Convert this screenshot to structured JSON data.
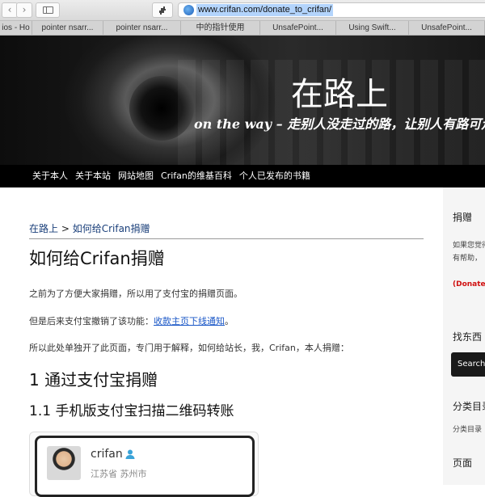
{
  "browser": {
    "nav_back": "‹",
    "nav_forward": "›",
    "url": "www.crifan.com/donate_to_crifan/",
    "tabs": [
      {
        "label": "ios - Ho",
        "width": 40
      },
      {
        "label": "pointer nsarr...",
        "width": 88
      },
      {
        "label": "pointer nsarr...",
        "width": 96
      },
      {
        "label": "中的指针使用",
        "width": 98
      },
      {
        "label": "UnsafePoint...",
        "width": 94
      },
      {
        "label": "Using Swift...",
        "width": 90
      },
      {
        "label": "UnsafePoint...",
        "width": 94
      }
    ]
  },
  "header": {
    "title": "在路上",
    "tagline": "on the way – 走别人没走过的路，让别人有路可走"
  },
  "nav": {
    "items": [
      "关于本人",
      "关于本站",
      "网站地图",
      "Crifan的维基百科",
      "个人已发布的书籍"
    ]
  },
  "content": {
    "breadcrumb_home": "在路上",
    "breadcrumb_sep": " > ",
    "breadcrumb_current": "如何给Crifan捐赠",
    "title": "如何给Crifan捐赠",
    "para1": "之前为了方便大家捐赠，所以用了支付宝的捐赠页面。",
    "para2_prefix": "但是后来支付宝撤销了该功能：",
    "para2_link": "收款主页下线通知",
    "para2_suffix": "。",
    "para3": "所以此处单独开了此页面，专门用于解释，如何给站长，我，Crifan，本人捐赠：",
    "h1": "1 通过支付宝捐赠",
    "h2": "1.1 手机版支付宝扫描二维码转账",
    "profile_name": "crifan",
    "profile_location": "江苏省 苏州市"
  },
  "sidebar": {
    "donate_heading": "捐赠",
    "donate_text1": "如果您觉得",
    "donate_text2": "有帮助，",
    "donate_label": "(Donate)",
    "search_heading": "找东西",
    "search_button": "Search",
    "category_heading": "分类目录",
    "category_text": "分类目录",
    "pages_heading": "页面"
  }
}
